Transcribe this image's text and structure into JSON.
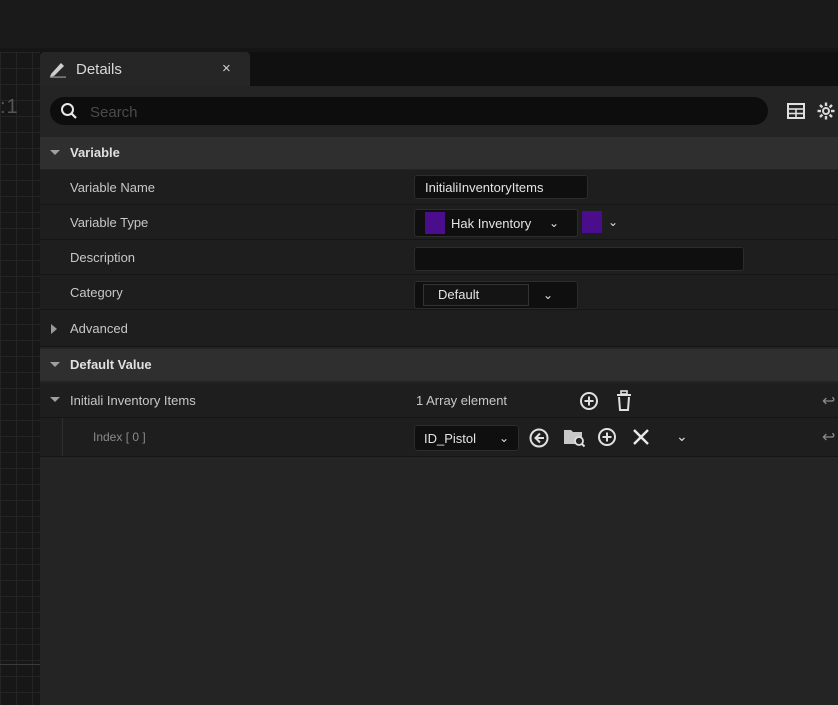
{
  "tab": {
    "title": "Details",
    "close": "×"
  },
  "left": {
    "ratio": ":1"
  },
  "search": {
    "placeholder": "Search"
  },
  "sections": {
    "variable": "Variable",
    "default_value": "Default Value"
  },
  "variable": {
    "name_label": "Variable Name",
    "name_value": "InitialiInventoryItems",
    "type_label": "Variable Type",
    "type_value": "Hak Inventory",
    "type_color": "#4a0d8c",
    "description_label": "Description",
    "description_value": "",
    "category_label": "Category",
    "category_value": "Default",
    "advanced_label": "Advanced"
  },
  "default_value": {
    "array_label": "Initiali Inventory Items",
    "array_count": "1 Array element",
    "index_label": "Index [ 0 ]",
    "index_value": "ID_Pistol"
  }
}
